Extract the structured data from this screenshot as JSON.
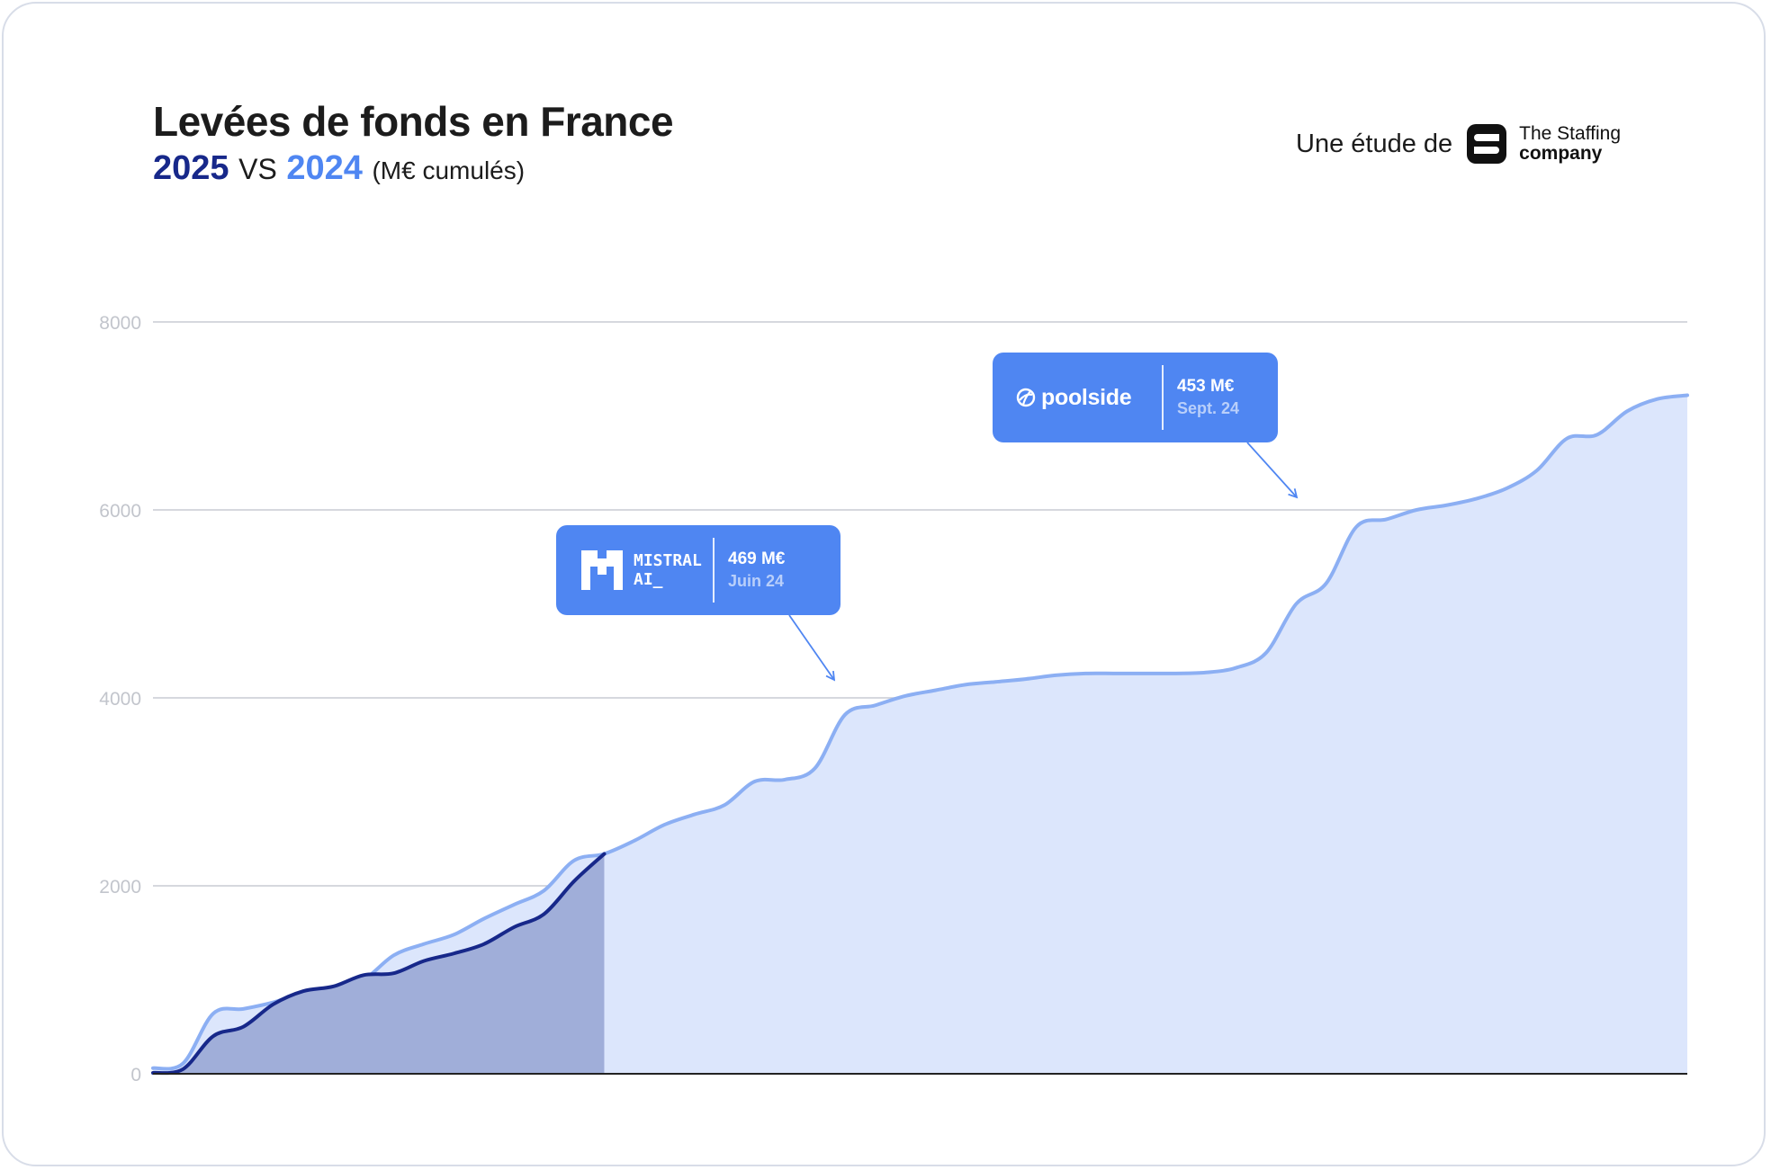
{
  "header": {
    "title": "Levées de fonds en France",
    "year_current": "2025",
    "vs": "VS",
    "year_previous": "2024",
    "unit": "(M€ cumulés)"
  },
  "brand": {
    "lead": "Une étude de",
    "name_line1": "The Staffing",
    "name_line2": "company"
  },
  "callouts": {
    "mistral": {
      "logo_line1": "MISTRAL",
      "logo_line2": "AI_",
      "value": "469 M€",
      "date": "Juin 24"
    },
    "poolside": {
      "logo": "poolside",
      "value": "453 M€",
      "date": "Sept. 24"
    }
  },
  "colors": {
    "series_2025_line": "#17288a",
    "series_2025_fill": "#a0aed9",
    "series_2024_line": "#8caff3",
    "series_2024_fill": "#dce6fc",
    "callout_bg": "#4f86f2",
    "grid": "#c9ccd4",
    "tick_label": "#c2c5cc"
  },
  "chart_data": {
    "type": "area",
    "x_unit": "week of year",
    "ylim": [
      0,
      8000
    ],
    "y_ticks": [
      "0",
      "2000",
      "4000",
      "6000",
      "8000"
    ],
    "grid": true,
    "series": [
      {
        "name": "2024",
        "x": [
          1,
          2,
          3,
          4,
          5,
          6,
          7,
          8,
          9,
          10,
          11,
          12,
          13,
          14,
          15,
          16,
          17,
          18,
          19,
          20,
          21,
          22,
          23,
          24,
          25,
          26,
          27,
          28,
          29,
          30,
          31,
          32,
          33,
          34,
          35,
          36,
          37,
          38,
          39,
          40,
          41,
          42,
          43,
          44,
          45,
          46,
          47,
          48,
          49,
          50,
          51,
          52
        ],
        "values": [
          60,
          110,
          640,
          690,
          760,
          860,
          900,
          1000,
          1260,
          1380,
          1480,
          1650,
          1800,
          1950,
          2270,
          2340,
          2480,
          2650,
          2760,
          2860,
          3110,
          3130,
          3250,
          3820,
          3920,
          4020,
          4080,
          4140,
          4170,
          4200,
          4240,
          4260,
          4260,
          4260,
          4260,
          4270,
          4320,
          4480,
          5000,
          5220,
          5820,
          5900,
          6000,
          6050,
          6120,
          6230,
          6420,
          6760,
          6800,
          7050,
          7180,
          7220
        ]
      },
      {
        "name": "2025",
        "x": [
          1,
          2,
          3,
          4,
          5,
          6,
          7,
          8,
          9,
          10,
          11,
          12,
          13,
          14,
          15,
          16
        ],
        "values": [
          10,
          50,
          400,
          500,
          740,
          880,
          930,
          1050,
          1070,
          1200,
          1280,
          1380,
          1560,
          1700,
          2050,
          2340
        ]
      }
    ],
    "annotations": [
      {
        "label": "469 M€",
        "date": "Juin 24",
        "company": "Mistral AI"
      },
      {
        "label": "453 M€",
        "date": "Sept. 24",
        "company": "poolside"
      }
    ]
  }
}
